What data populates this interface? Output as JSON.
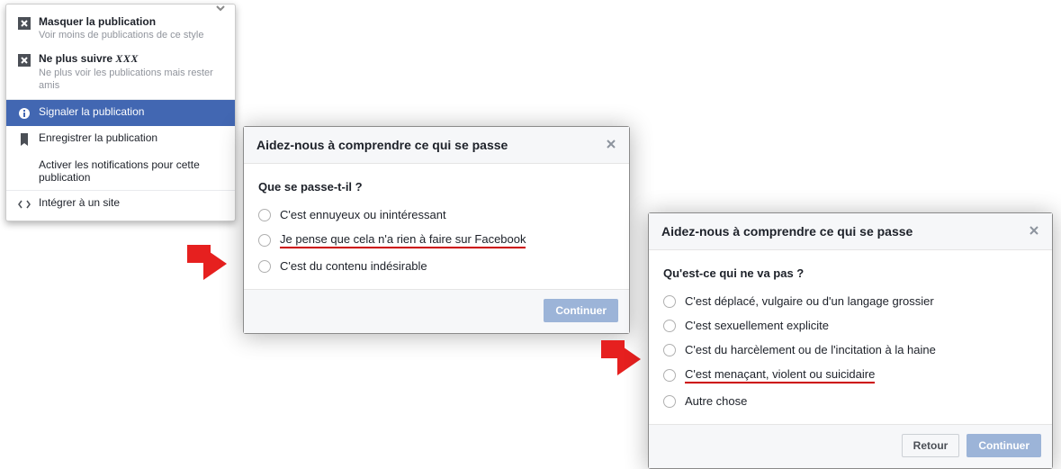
{
  "menu": {
    "hide": {
      "title": "Masquer la publication",
      "sub": "Voir moins de publications de ce style"
    },
    "unfollow_prefix": "Ne plus suivre ",
    "unfollow_name": "XXX",
    "unfollow_sub": "Ne plus voir les publications mais rester amis",
    "report": "Signaler la publication",
    "save": "Enregistrer la publication",
    "notify": "Activer les notifications pour cette publication",
    "embed": "Intégrer à un site"
  },
  "dialog1": {
    "title": "Aidez-nous à comprendre ce qui se passe",
    "question": "Que se passe-t-il ?",
    "opts": [
      "C'est ennuyeux ou inintéressant",
      "Je pense que cela n'a rien à faire sur Facebook",
      "C'est du contenu indésirable"
    ],
    "continue": "Continuer"
  },
  "dialog2": {
    "title": "Aidez-nous à comprendre ce qui se passe",
    "question": "Qu'est-ce qui ne va pas ?",
    "opts": [
      "C'est déplacé, vulgaire ou d'un langage grossier",
      "C'est sexuellement explicite",
      "C'est du harcèlement ou de l'incitation à la haine",
      "C'est menaçant, violent ou suicidaire",
      "Autre chose"
    ],
    "back": "Retour",
    "continue": "Continuer"
  }
}
